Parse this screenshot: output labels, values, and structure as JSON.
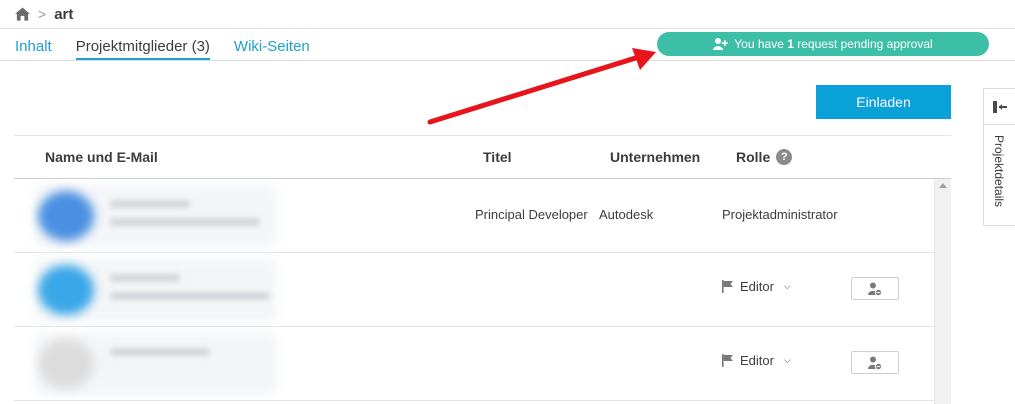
{
  "breadcrumb": {
    "home_icon": "home-icon",
    "separator": ">",
    "current": "art"
  },
  "tabs": [
    {
      "label": "Inhalt",
      "active": false
    },
    {
      "label": "Projektmitglieder (3)",
      "active": true
    },
    {
      "label": "Wiki-Seiten",
      "active": false
    }
  ],
  "pending": {
    "prefix": "You have ",
    "count": "1",
    "suffix": " request pending approval",
    "icon": "user-plus-icon"
  },
  "invite_label": "Einladen",
  "side_panel": {
    "label": "Projektdetails",
    "icon": "collapse-panel-icon"
  },
  "table": {
    "headers": {
      "name": "Name und E-Mail",
      "title": "Titel",
      "company": "Unternehmen",
      "role": "Rolle",
      "help": "?"
    },
    "rows": [
      {
        "title": "Principal Developer",
        "company": "Autodesk",
        "role": "Projektadministrator",
        "avatar_color": "#4a90e2"
      },
      {
        "title": "",
        "company": "",
        "role": "Editor",
        "avatar_color": "#3aa7e8"
      },
      {
        "title": "",
        "company": "",
        "role": "Editor",
        "avatar_color": "#dcdcdc"
      }
    ]
  },
  "colors": {
    "accent": "#1e9fcf",
    "pending_bg": "#3dbfa7",
    "invite_bg": "#0aa0d8",
    "annotation_arrow": "#e8141c"
  }
}
